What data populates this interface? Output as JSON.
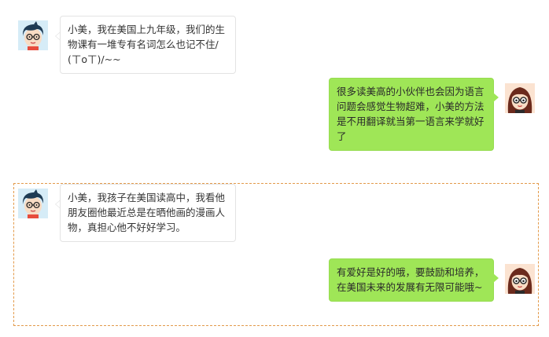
{
  "conversation": {
    "messages": [
      {
        "side": "left",
        "text": "小美，我在美国上九年级，我们的生物课有一堆专有名词怎么也记不住/(ㄒoㄒ)/~~"
      },
      {
        "side": "right",
        "text": "很多读美高的小伙伴也会因为语言问题会感觉生物超难，小美的方法是不用翻译就当第一语言来学就好了"
      },
      {
        "side": "left",
        "text": "小美，我孩子在美国读高中，我看他朋友圈他最近总是在晒他画的漫画人物，真担心他不好好学习。"
      },
      {
        "side": "right",
        "text": "有爱好是好的哦，要鼓励和培养，在美国未来的发展有无限可能哦~"
      }
    ]
  },
  "colors": {
    "reply_bubble": "#9fe657",
    "user_bubble": "#ffffff",
    "highlight_border": "#e39a4a"
  },
  "icons": {
    "user": "boy-avatar-icon",
    "assistant": "girl-avatar-icon"
  }
}
